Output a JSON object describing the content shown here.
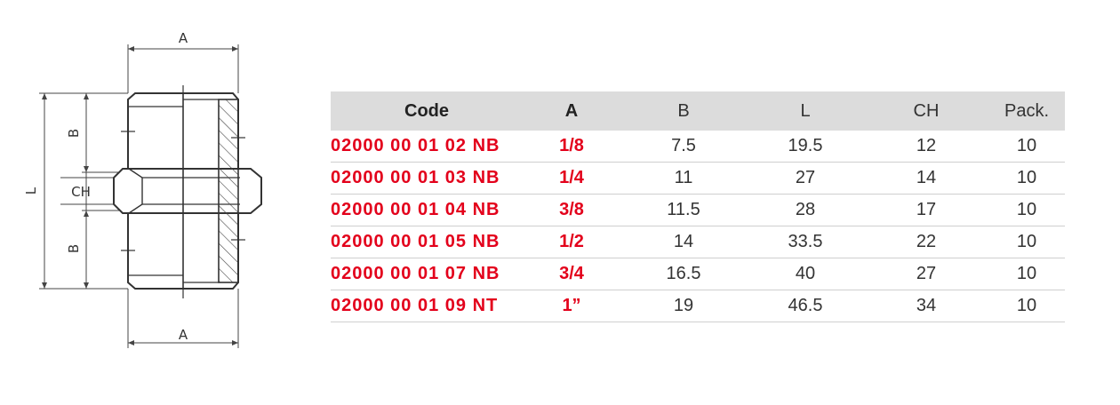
{
  "drawing": {
    "dimension_labels": {
      "a_top": "A",
      "a_bottom": "A",
      "b_upper": "B",
      "b_lower": "B",
      "l": "L",
      "ch": "CH"
    }
  },
  "table": {
    "headers": {
      "code": "Code",
      "a": "A",
      "b": "B",
      "l": "L",
      "ch": "CH",
      "pack": "Pack."
    },
    "rows": [
      {
        "code": "02000 00 01 02 NB",
        "a": "1/8",
        "b": "7.5",
        "l": "19.5",
        "ch": "12",
        "pack": "10"
      },
      {
        "code": "02000 00 01 03 NB",
        "a": "1/4",
        "b": "11",
        "l": "27",
        "ch": "14",
        "pack": "10"
      },
      {
        "code": "02000 00 01 04 NB",
        "a": "3/8",
        "b": "11.5",
        "l": "28",
        "ch": "17",
        "pack": "10"
      },
      {
        "code": "02000 00 01 05 NB",
        "a": "1/2",
        "b": "14",
        "l": "33.5",
        "ch": "22",
        "pack": "10"
      },
      {
        "code": "02000 00 01 07 NB",
        "a": "3/4",
        "b": "16.5",
        "l": "40",
        "ch": "27",
        "pack": "10"
      },
      {
        "code": "02000 00 01 09 NT",
        "a": "1”",
        "b": "19",
        "l": "46.5",
        "ch": "34",
        "pack": "10"
      }
    ]
  }
}
